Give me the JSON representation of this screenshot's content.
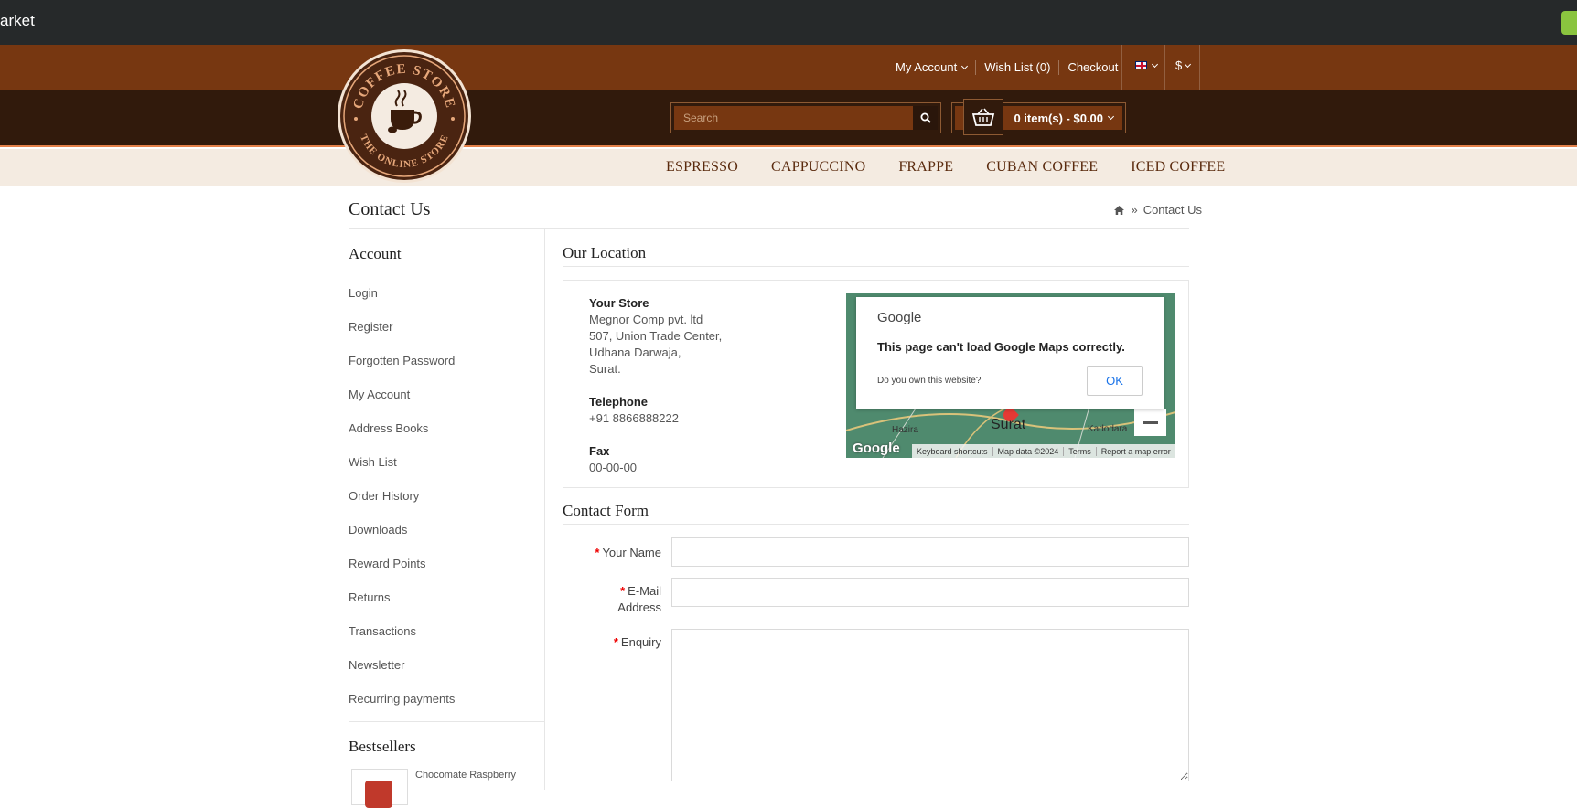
{
  "topbar": {
    "brand": "arket"
  },
  "nav": {
    "my_account": "My Account",
    "wish_list": "Wish List (0)",
    "checkout": "Checkout",
    "currency": "$"
  },
  "search": {
    "placeholder": "Search"
  },
  "cart": {
    "label": "0 item(s) - $0.00"
  },
  "logo": {
    "top_text": "COFFEE STORE",
    "bottom_text": "THE ONLINE STORE"
  },
  "menu": [
    "ESPRESSO",
    "CAPPUCCINO",
    "FRAPPE",
    "CUBAN COFFEE",
    "ICED COFFEE"
  ],
  "page": {
    "title": "Contact Us",
    "breadcrumb_current": "Contact Us"
  },
  "sidebar": {
    "heading": "Account",
    "items": [
      "Login",
      "Register",
      "Forgotten Password",
      "My Account",
      "Address Books",
      "Wish List",
      "Order History",
      "Downloads",
      "Reward Points",
      "Returns",
      "Transactions",
      "Newsletter",
      "Recurring payments"
    ],
    "bestsellers_heading": "Bestsellers",
    "bestseller_name": "Chocomate Raspberry"
  },
  "location": {
    "heading": "Our Location",
    "store_name": "Your Store",
    "address_lines": [
      "Megnor Comp pvt. ltd",
      "507, Union Trade Center,",
      "Udhana Darwaja,",
      "Surat."
    ],
    "telephone_label": "Telephone",
    "telephone": "+91 8866888222",
    "fax_label": "Fax",
    "fax": "00-00-00"
  },
  "map": {
    "dialog_brand": "Google",
    "dialog_message": "This page can't load Google Maps correctly.",
    "dialog_own": "Do you own this website?",
    "dialog_ok": "OK",
    "city": "Surat",
    "places": [
      "Hazira",
      "Kadodara"
    ],
    "attribution": [
      "Keyboard shortcuts",
      "Map data ©2024",
      "Terms",
      "Report a map error"
    ],
    "logo_text": "Google"
  },
  "form": {
    "heading": "Contact Form",
    "name_label": "Your Name",
    "email_label_1": "E-Mail",
    "email_label_2": "Address",
    "enquiry_label": "Enquiry",
    "required_mark": "*"
  },
  "colors": {
    "topbar": "#26292a",
    "nav": "#773711",
    "header": "#311a0c",
    "menu_bg": "#f4ebe1",
    "menu_text": "#5a2a0d",
    "accent": "#e3814a"
  }
}
